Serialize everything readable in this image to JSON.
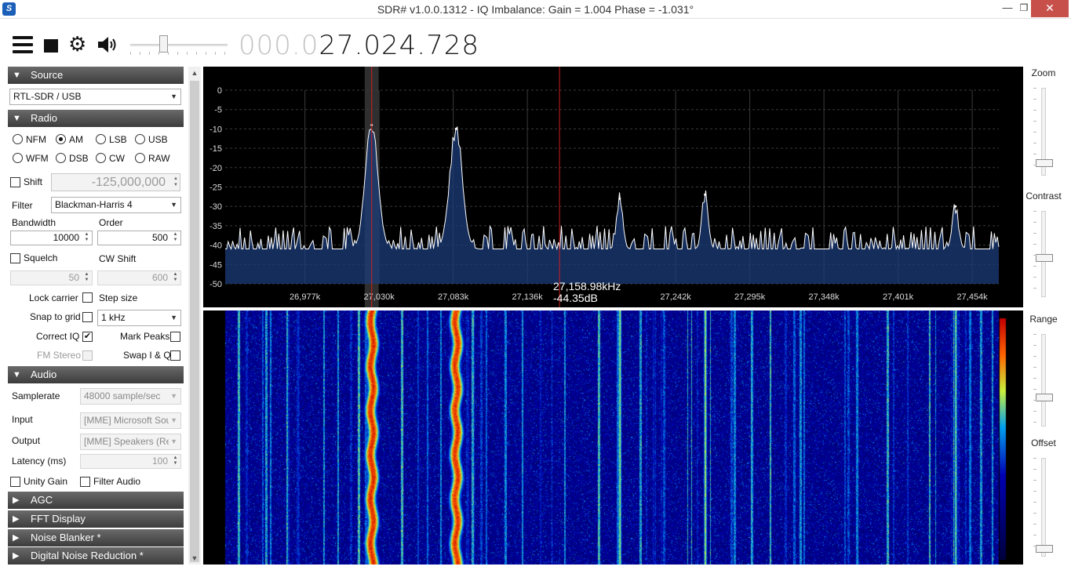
{
  "window": {
    "title": "SDR# v1.0.0.1312 - IQ Imbalance: Gain = 1.004 Phase = -1.031°",
    "app_icon_glyph": "S",
    "minimize_glyph": "—",
    "maximize_glyph": "❐",
    "close_glyph": "✕"
  },
  "toolbar": {
    "frequency_dim": "000.0",
    "frequency_lit": "27.024.728",
    "volume_fraction": 0.33,
    "gear_glyph": "⚙"
  },
  "sections": {
    "source": "Source",
    "radio": "Radio",
    "audio": "Audio",
    "agc": "AGC",
    "fft_display": "FFT Display",
    "noise_blanker": "Noise Blanker *",
    "digital_noise_reduction": "Digital Noise Reduction *",
    "expanded_glyph": "▼",
    "collapsed_glyph": "▶"
  },
  "source": {
    "device": "RTL-SDR / USB"
  },
  "radio": {
    "modes": [
      "NFM",
      "AM",
      "LSB",
      "USB",
      "WFM",
      "DSB",
      "CW",
      "RAW"
    ],
    "selected_mode": "AM",
    "shift_label": "Shift",
    "shift_value": "-125,000,000",
    "filter_label": "Filter",
    "filter_value": "Blackman-Harris 4",
    "bandwidth_label": "Bandwidth",
    "bandwidth_value": "10000",
    "order_label": "Order",
    "order_value": "500",
    "squelch_label": "Squelch",
    "squelch_value": "50",
    "cw_shift_label": "CW Shift",
    "cw_shift_value": "600",
    "lock_carrier_label": "Lock carrier",
    "step_size_label": "Step size",
    "snap_to_grid_label": "Snap to grid",
    "step_size_value": "1 kHz",
    "correct_iq_label": "Correct IQ",
    "mark_peaks_label": "Mark Peaks",
    "fm_stereo_label": "FM Stereo",
    "swap_iq_label": "Swap I & Q",
    "check_glyph": "✔"
  },
  "audio": {
    "samplerate_label": "Samplerate",
    "samplerate_value": "48000 sample/sec",
    "input_label": "Input",
    "input_value": "[MME] Microsoft Soun",
    "output_label": "Output",
    "output_value": "[MME] Speakers (Rea",
    "latency_label": "Latency (ms)",
    "latency_value": "100",
    "unity_gain_label": "Unity Gain",
    "filter_audio_label": "Filter Audio"
  },
  "right_panel": {
    "zoom_label": "Zoom",
    "contrast_label": "Contrast",
    "range_label": "Range",
    "offset_label": "Offset"
  },
  "cursor": {
    "frequency": "27,158.98kHz",
    "level": "-44.35dB"
  },
  "chart_data": {
    "type": "line",
    "title": "",
    "xlabel": "",
    "ylabel": "",
    "x_ticks": [
      "26,977k",
      "27,030k",
      "27,083k",
      "27,136k",
      "27,242k",
      "27,295k",
      "27,348k",
      "27,401k",
      "27,454k"
    ],
    "x_tick_values_khz": [
      26977,
      27030,
      27083,
      27136,
      27242,
      27295,
      27348,
      27401,
      27454
    ],
    "y_ticks": [
      "0",
      "-5",
      "-10",
      "-15",
      "-20",
      "-25",
      "-30",
      "-35",
      "-40",
      "-45",
      "-50"
    ],
    "y_tick_values": [
      0,
      -5,
      -10,
      -15,
      -20,
      -25,
      -30,
      -35,
      -40,
      -45,
      -50
    ],
    "xlim_khz": [
      26920,
      27473
    ],
    "ylim": [
      -50,
      0
    ],
    "grid": true,
    "noise_floor_db": -41,
    "peaks": [
      {
        "freq_khz": 27024.7,
        "level_db": -9
      },
      {
        "freq_khz": 27085,
        "level_db": -10
      },
      {
        "freq_khz": 27202,
        "level_db": -28
      },
      {
        "freq_khz": 27263,
        "level_db": -27
      },
      {
        "freq_khz": 27442,
        "level_db": -30
      }
    ],
    "tuned_freq_khz": 27024.728,
    "cursor_freq_khz": 27158.98,
    "colors": {
      "trace": "#ffffff",
      "fill": "#1c3c7a",
      "grid": "#3a3a3a",
      "cursor": "#d02020",
      "passband": "#555555"
    }
  }
}
